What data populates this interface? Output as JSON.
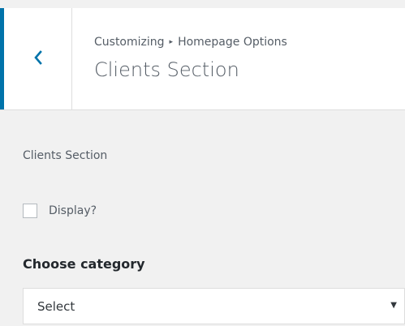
{
  "header": {
    "breadcrumb": {
      "parent": "Customizing",
      "separator": "▸",
      "current": "Homepage Options"
    },
    "title": "Clients Section",
    "back_icon": "chevron-left-icon",
    "accent_color": "#0073aa"
  },
  "panel": {
    "description": "Clients Section",
    "display_checkbox": {
      "label": "Display?",
      "checked": false
    },
    "category_field": {
      "title": "Choose category",
      "selected": "Select",
      "arrow": "▼"
    }
  }
}
